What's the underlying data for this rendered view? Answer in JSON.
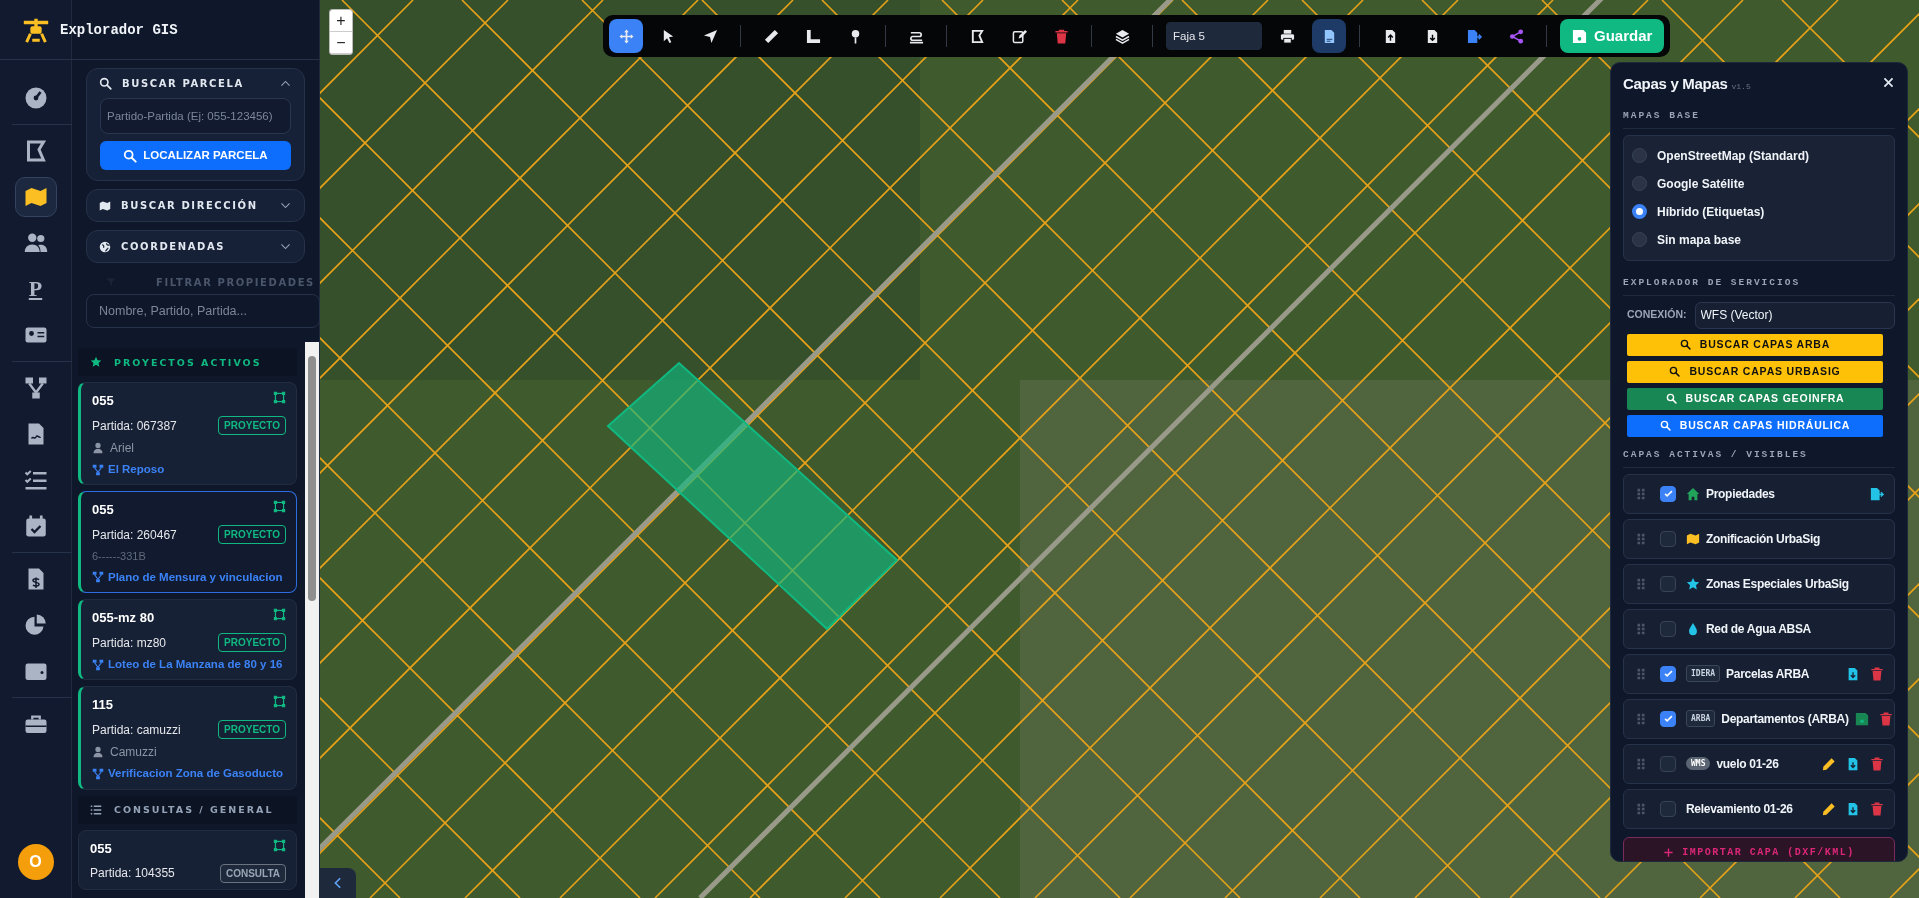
{
  "rail": {
    "items": [
      {
        "kind": "gauge",
        "selected": false
      },
      {
        "kind": "divider"
      },
      {
        "kind": "shape",
        "selected": false
      },
      {
        "kind": "map",
        "selected": true
      },
      {
        "kind": "users",
        "selected": false
      },
      {
        "kind": "letter",
        "label": "P",
        "selected": false
      },
      {
        "kind": "idcard",
        "selected": false
      },
      {
        "kind": "divider"
      },
      {
        "kind": "network",
        "selected": false
      },
      {
        "kind": "document",
        "selected": false
      },
      {
        "kind": "checklist",
        "selected": false
      },
      {
        "kind": "calendar",
        "selected": false
      },
      {
        "kind": "divider"
      },
      {
        "kind": "invoice",
        "selected": false
      },
      {
        "kind": "pie",
        "selected": false
      },
      {
        "kind": "wallet",
        "selected": false
      },
      {
        "kind": "divider"
      },
      {
        "kind": "toolbox",
        "selected": false
      }
    ],
    "avatar": "O"
  },
  "sidebar": {
    "title": "Explorador GIS",
    "parcel_search": {
      "title": "BUSCAR PARCELA",
      "expanded": true,
      "placeholder": "Partido-Partida (Ej: 055-123456)",
      "button": "LOCALIZAR PARCELA"
    },
    "sections": [
      {
        "kind": "address",
        "title": "BUSCAR DIRECCIÓN",
        "expanded": false
      },
      {
        "kind": "coords",
        "title": "COORDENADAS",
        "expanded": false
      }
    ],
    "filter": {
      "title": "FILTRAR PROPIEDADES",
      "placeholder": "Nombre, Partido, Partida..."
    },
    "groups": [
      {
        "kind": "projects",
        "title": "PROYECTOS ACTIVOS",
        "items": [
          {
            "code": "055",
            "partida": "Partida: 067387",
            "badge": "PROYECTO",
            "owner": "Ariel",
            "project": "El Reposo",
            "selected": false
          },
          {
            "code": "055",
            "partida": "Partida: 260467",
            "badge": "PROYECTO",
            "note": "6------331B",
            "project": "Plano de Mensura y vinculacion",
            "selected": true
          },
          {
            "code": "055-mz 80",
            "partida": "Partida: mz80",
            "badge": "PROYECTO",
            "project": "Loteo de La Manzana de 80 y 16",
            "selected": false
          },
          {
            "code": "115",
            "partida": "Partida: camuzzi",
            "badge": "PROYECTO",
            "owner": "Camuzzi",
            "project": "Verificacion Zona de Gasoducto",
            "selected": false
          }
        ]
      },
      {
        "kind": "queries",
        "title": "CONSULTAS / GENERAL",
        "items": [
          {
            "code": "055",
            "partida": "Partida: 104355",
            "badge": "CONSULTA",
            "selected": false
          }
        ]
      }
    ]
  },
  "map": {
    "zoom_in": "+",
    "zoom_out": "−"
  },
  "toolbar": {
    "tools": [
      {
        "kind": "move",
        "selected": true
      },
      {
        "kind": "pointer",
        "selected": false
      },
      {
        "kind": "navarrow",
        "selected": false
      },
      {
        "kind": "separator"
      },
      {
        "kind": "ruler",
        "selected": false
      },
      {
        "kind": "rulercorner",
        "selected": false
      },
      {
        "kind": "pin",
        "selected": false
      },
      {
        "kind": "separator"
      },
      {
        "kind": "signature",
        "selected": false
      },
      {
        "kind": "separator"
      },
      {
        "kind": "shape",
        "selected": false
      },
      {
        "kind": "edit",
        "selected": false
      },
      {
        "kind": "trash",
        "selected": false
      },
      {
        "kind": "separator"
      },
      {
        "kind": "layers",
        "selected": false
      },
      {
        "kind": "separator"
      },
      {
        "kind": "field",
        "value": "Faja 5"
      },
      {
        "kind": "print",
        "selected": false
      },
      {
        "kind": "pdf",
        "selected": true
      },
      {
        "kind": "separator"
      },
      {
        "kind": "fileup",
        "selected": false
      },
      {
        "kind": "filedown",
        "selected": false
      },
      {
        "kind": "fileexport",
        "selected": false
      },
      {
        "kind": "share",
        "selected": false
      },
      {
        "kind": "separator"
      },
      {
        "kind": "save",
        "label": "Guardar"
      }
    ]
  },
  "layers_panel": {
    "title": "Capas y Mapas",
    "version": "v1.5",
    "base_title": "MAPAS BASE",
    "base_maps": [
      {
        "label": "OpenStreetMap (Standard)",
        "selected": false
      },
      {
        "label": "Google Satélite",
        "selected": false
      },
      {
        "label": "Híbrido (Etiquetas)",
        "selected": true
      },
      {
        "label": "Sin mapa base",
        "selected": false
      }
    ],
    "services_title": "EXPLORADOR DE SERVICIOS",
    "connection_label": "CONEXIÓN:",
    "connection_value": "WFS (Vector)",
    "service_buttons": [
      {
        "label": "BUSCAR CAPAS ARBA",
        "color": "#ffc107"
      },
      {
        "label": "BUSCAR CAPAS URBASIG",
        "color": "#ffc107"
      },
      {
        "label": "BUSCAR CAPAS GEOINFRA",
        "color": "#198754"
      },
      {
        "label": "BUSCAR CAPAS HIDRÁULICA",
        "color": "#0d6efd"
      }
    ],
    "active_title": "CAPAS ACTIVAS / VISIBLES",
    "layers": [
      {
        "kind": "icon",
        "name": "Propiedades",
        "checked": true
      },
      {
        "kind": "icon",
        "name": "Zonificación UrbaSig",
        "checked": false
      },
      {
        "kind": "icon",
        "name": "Zonas Especiales UrbaSig",
        "checked": false
      },
      {
        "kind": "icon",
        "name": "Red de Agua ABSA",
        "checked": false
      },
      {
        "kind": "box",
        "name": "Parcelas ARBA",
        "checked": true,
        "tag": "IDERA"
      },
      {
        "kind": "box",
        "name": "Departamentos (ARBA)",
        "checked": true,
        "tag": "ARBA"
      },
      {
        "kind": "pill",
        "name": "vuelo 01-26",
        "checked": false,
        "tag": "WMS"
      },
      {
        "kind": "plain",
        "name": "Relevamiento 01-26",
        "checked": false
      }
    ],
    "import_button": "IMPORTAR CAPA (DXF/KML)"
  }
}
